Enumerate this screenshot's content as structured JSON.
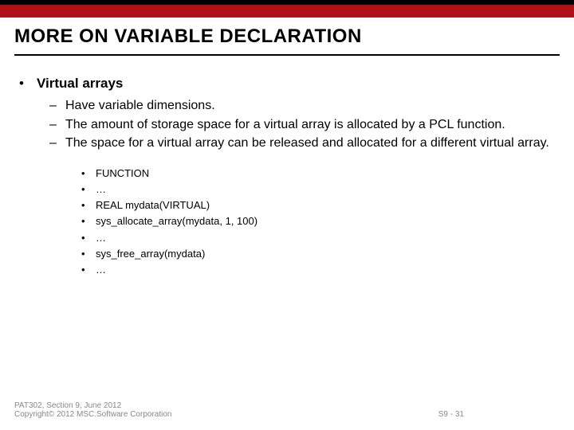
{
  "header": {
    "title": "MORE ON VARIABLE DECLARATION"
  },
  "body": {
    "topic_bullet": "•",
    "topic": "Virtual arrays",
    "points": [
      {
        "dash": "–",
        "text": "Have variable dimensions."
      },
      {
        "dash": "–",
        "text": "The amount of storage space for a virtual array is allocated by a PCL function."
      },
      {
        "dash": "–",
        "text": "The space for a virtual array can be released and allocated for a different virtual array."
      }
    ],
    "code": [
      {
        "dot": "•",
        "text": "FUNCTION"
      },
      {
        "dot": "•",
        "text": "…"
      },
      {
        "dot": "•",
        "text": "REAL mydata(VIRTUAL)"
      },
      {
        "dot": "•",
        "text": "sys_allocate_array(mydata, 1, 100)"
      },
      {
        "dot": "•",
        "text": "…"
      },
      {
        "dot": "•",
        "text": "sys_free_array(mydata)"
      },
      {
        "dot": "•",
        "text": "…"
      }
    ]
  },
  "footer": {
    "line1": "PAT302, Section 9, June 2012",
    "line2": "Copyright© 2012 MSC.Software Corporation",
    "page": "S9 - 31"
  }
}
